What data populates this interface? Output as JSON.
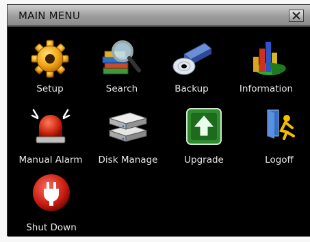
{
  "window": {
    "title": "MAIN MENU",
    "close_glyph": "✕"
  },
  "menu": {
    "items": [
      {
        "label": "Setup",
        "icon": "gear-icon"
      },
      {
        "label": "Search",
        "icon": "magnifier-books-icon"
      },
      {
        "label": "Backup",
        "icon": "disc-drive-icon"
      },
      {
        "label": "Information",
        "icon": "bar-chart-icon"
      },
      {
        "label": "Manual Alarm",
        "icon": "alarm-siren-icon"
      },
      {
        "label": "Disk Manage",
        "icon": "hard-disk-icon"
      },
      {
        "label": "Upgrade",
        "icon": "upgrade-arrow-icon"
      },
      {
        "label": "Logoff",
        "icon": "logoff-door-icon"
      },
      {
        "label": "Shut Down",
        "icon": "power-plug-icon"
      }
    ]
  }
}
